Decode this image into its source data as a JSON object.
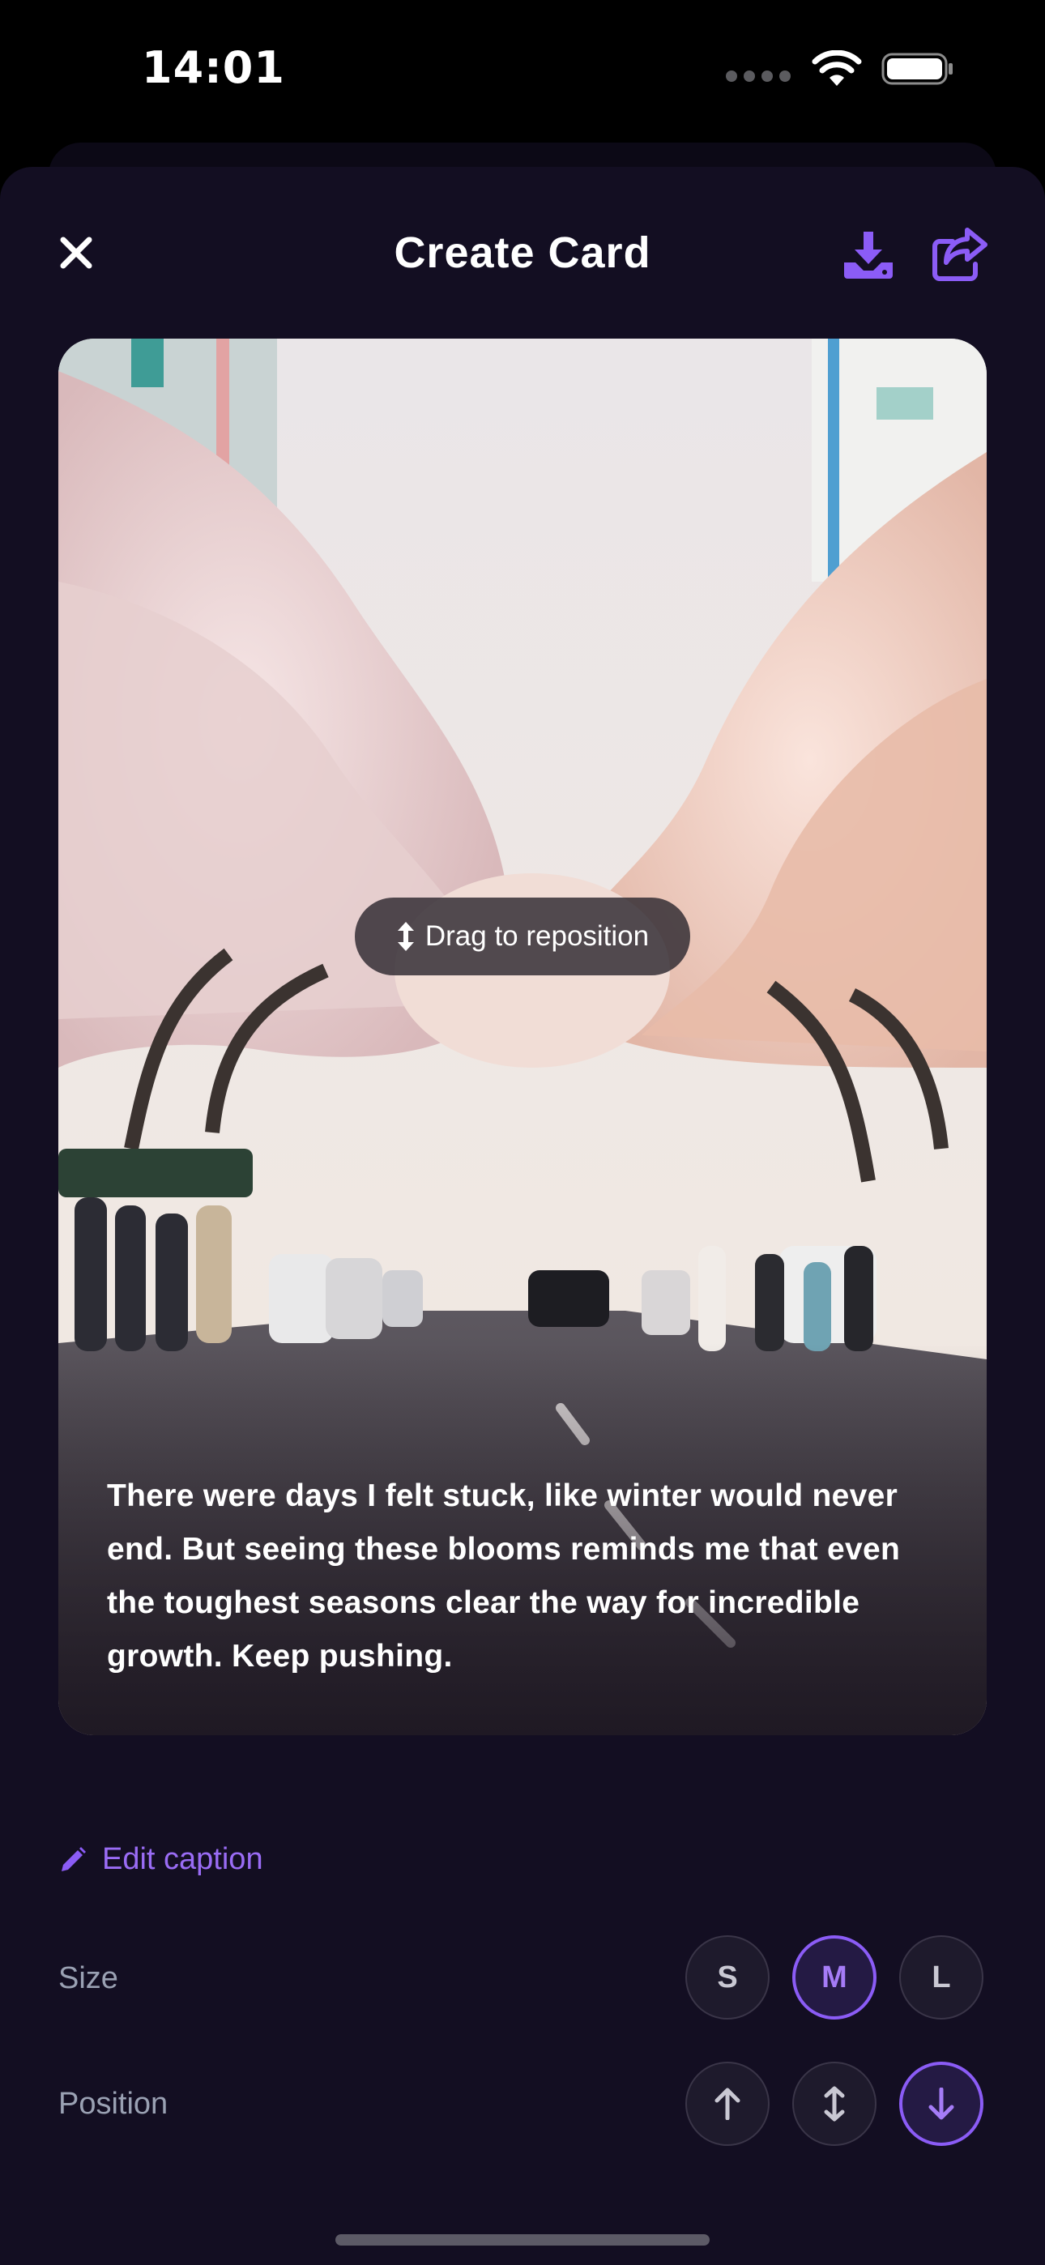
{
  "status_bar": {
    "time": "14:01"
  },
  "header": {
    "title": "Create Card"
  },
  "card": {
    "drag_hint": "Drag to reposition",
    "caption": "There were days I felt stuck, like winter would never end. But seeing these blooms reminds me that even the toughest seasons clear the way for incredible growth. Keep pushing."
  },
  "controls": {
    "edit_caption": "Edit caption",
    "size": {
      "label": "Size",
      "options": [
        "S",
        "M",
        "L"
      ],
      "selected": "M"
    },
    "position": {
      "label": "Position",
      "options": [
        "top",
        "center",
        "bottom"
      ],
      "selected": "bottom"
    }
  },
  "icons": {
    "close": "close-icon",
    "download": "download-icon",
    "share": "share-icon",
    "drag": "vertical-arrows-icon",
    "edit": "pencil-icon",
    "position_top": "arrow-up-icon",
    "position_center": "vertical-arrows-icon",
    "position_bottom": "arrow-down-icon"
  },
  "colors": {
    "accent": "#8b5cf6",
    "background": "#130e22"
  }
}
